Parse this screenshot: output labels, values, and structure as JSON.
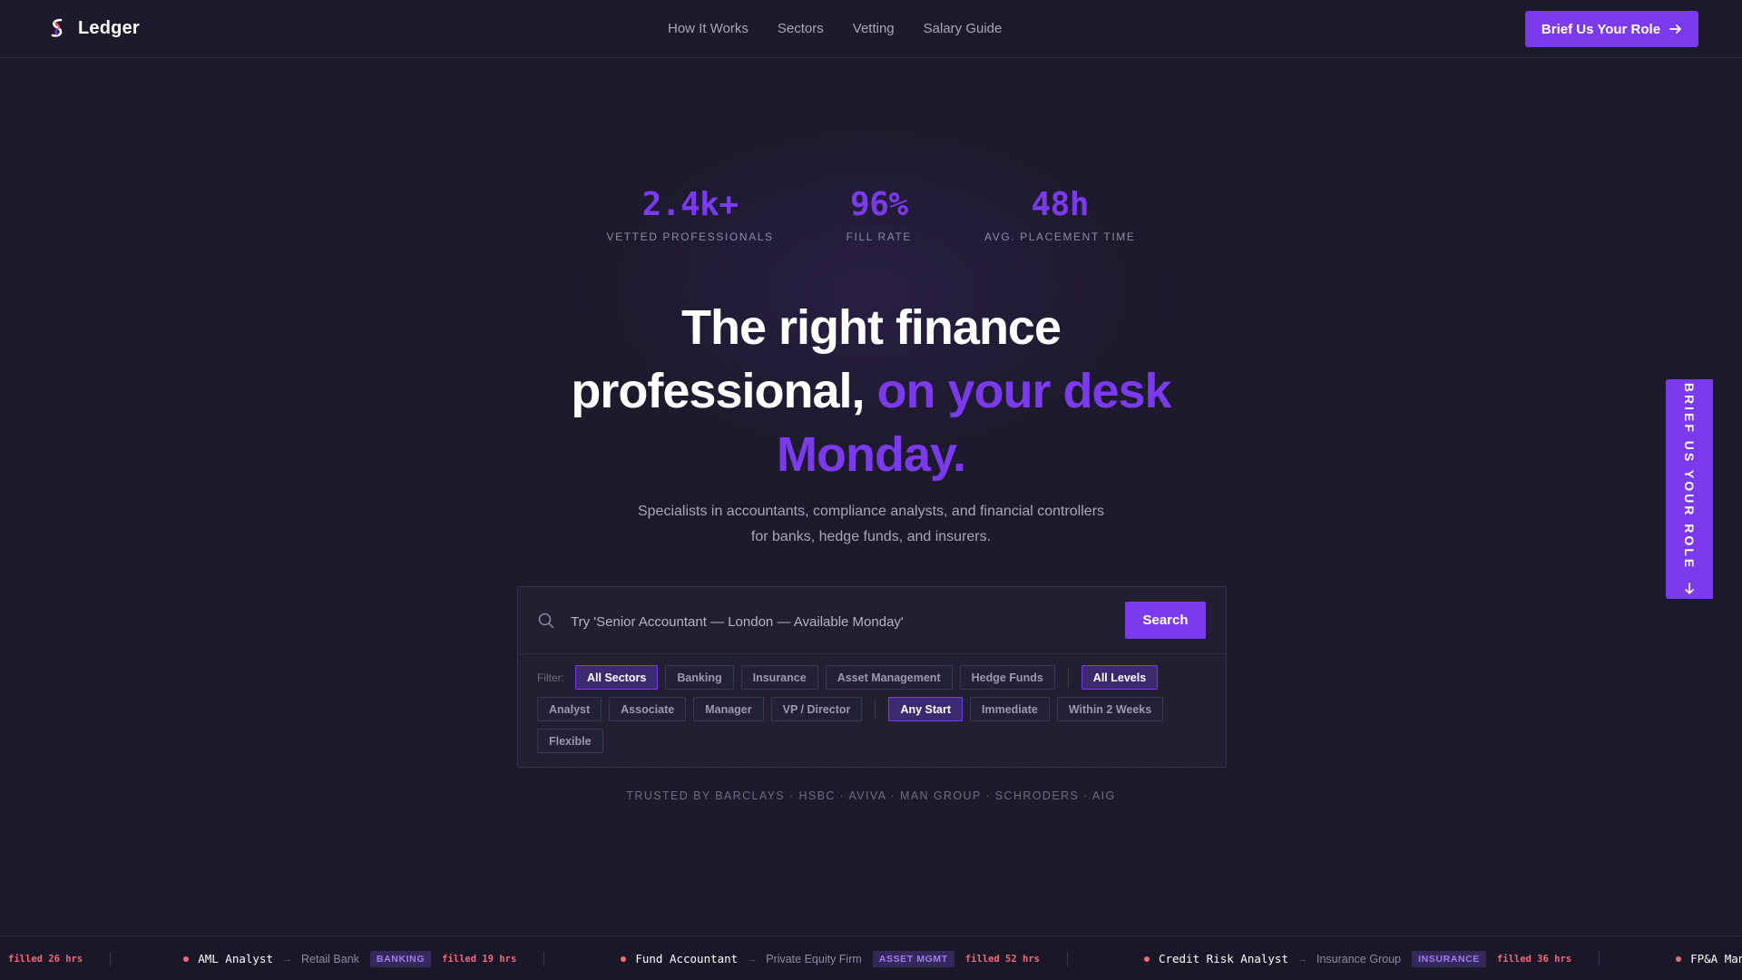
{
  "nav": {
    "brand": "Ledger",
    "links": [
      "How It Works",
      "Sectors",
      "Vetting",
      "Salary Guide"
    ],
    "cta": "Brief Us Your Role"
  },
  "stats": [
    {
      "value": "2.4k+",
      "label": "VETTED PROFESSIONALS"
    },
    {
      "value": "96%",
      "label": "FILL RATE"
    },
    {
      "value": "48h",
      "label": "AVG. PLACEMENT TIME"
    }
  ],
  "hero": {
    "title_line1": "The right finance",
    "title_line2_plain": "professional,",
    "title_line2_accent": "on your desk",
    "title_line3_accent": "Monday.",
    "sub_line1": "Specialists in accountants, compliance analysts, and financial controllers",
    "sub_line2": "for banks, hedge funds, and insurers."
  },
  "search": {
    "placeholder": "Try 'Senior Accountant — London — Available Monday'",
    "button": "Search",
    "filter_label": "Filter:",
    "sector_chips": [
      "All Sectors",
      "Banking",
      "Insurance",
      "Asset Management",
      "Hedge Funds"
    ],
    "level_chips": [
      "All Levels",
      "Analyst",
      "Associate",
      "Manager",
      "VP / Director"
    ],
    "start_chips": [
      "Any Start",
      "Immediate",
      "Within 2 Weeks",
      "Flexible"
    ],
    "active": [
      "All Sectors",
      "All Levels",
      "Any Start"
    ]
  },
  "trusted": "TRUSTED BY BARCLAYS · HSBC · AVIVA · MAN GROUP · SCHRODERS · AIG",
  "side_tab": "BRIEF US YOUR ROLE",
  "ticker": {
    "leading_filled": "filled 26 hrs",
    "items": [
      {
        "role": "AML Analyst",
        "company": "Retail Bank",
        "tag": "BANKING",
        "filled": "filled 19 hrs"
      },
      {
        "role": "Fund Accountant",
        "company": "Private Equity Firm",
        "tag": "ASSET MGMT",
        "filled": "filled 52 hrs"
      },
      {
        "role": "Credit Risk Analyst",
        "company": "Insurance Group",
        "tag": "INSURANCE",
        "filled": "filled 36 hrs"
      },
      {
        "role": "FP&A Manager",
        "company": "",
        "tag": "",
        "filled": ""
      }
    ]
  },
  "colors": {
    "accent": "#7c3aed",
    "background": "#1c1a2b",
    "panel": "#211f31",
    "ticker_red": "#ef6b7b"
  }
}
